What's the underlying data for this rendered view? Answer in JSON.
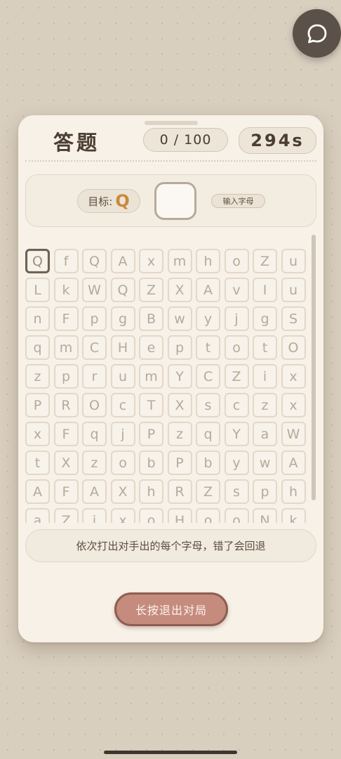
{
  "header": {
    "title": "答题",
    "score": "0 / 100",
    "timer": "294s"
  },
  "target": {
    "label": "目标:",
    "letter": "Q",
    "input_hint": "输入字母"
  },
  "grid": {
    "current_index": 0,
    "letters": [
      "Q",
      "f",
      "Q",
      "A",
      "x",
      "m",
      "h",
      "o",
      "Z",
      "u",
      "L",
      "k",
      "W",
      "Q",
      "Z",
      "X",
      "A",
      "v",
      "I",
      "u",
      "n",
      "F",
      "p",
      "g",
      "B",
      "w",
      "y",
      "j",
      "g",
      "S",
      "q",
      "m",
      "C",
      "H",
      "e",
      "p",
      "t",
      "o",
      "t",
      "O",
      "z",
      "p",
      "r",
      "u",
      "m",
      "Y",
      "C",
      "Z",
      "i",
      "x",
      "P",
      "R",
      "O",
      "c",
      "T",
      "X",
      "s",
      "c",
      "z",
      "x",
      "x",
      "F",
      "q",
      "j",
      "P",
      "z",
      "q",
      "Y",
      "a",
      "W",
      "t",
      "X",
      "z",
      "o",
      "b",
      "P",
      "b",
      "y",
      "w",
      "A",
      "A",
      "F",
      "A",
      "X",
      "h",
      "R",
      "Z",
      "s",
      "p",
      "h",
      "a",
      "Z",
      "j",
      "x",
      "o",
      "H",
      "o",
      "o",
      "N",
      "k"
    ]
  },
  "instruction": "依次打出对手出的每个字母，错了会回退",
  "exit_button": "长按退出对局",
  "icons": {
    "chat": "chat-bubble-icon"
  },
  "colors": {
    "accent": "#c98a3a",
    "exit": "#c58c7e"
  }
}
